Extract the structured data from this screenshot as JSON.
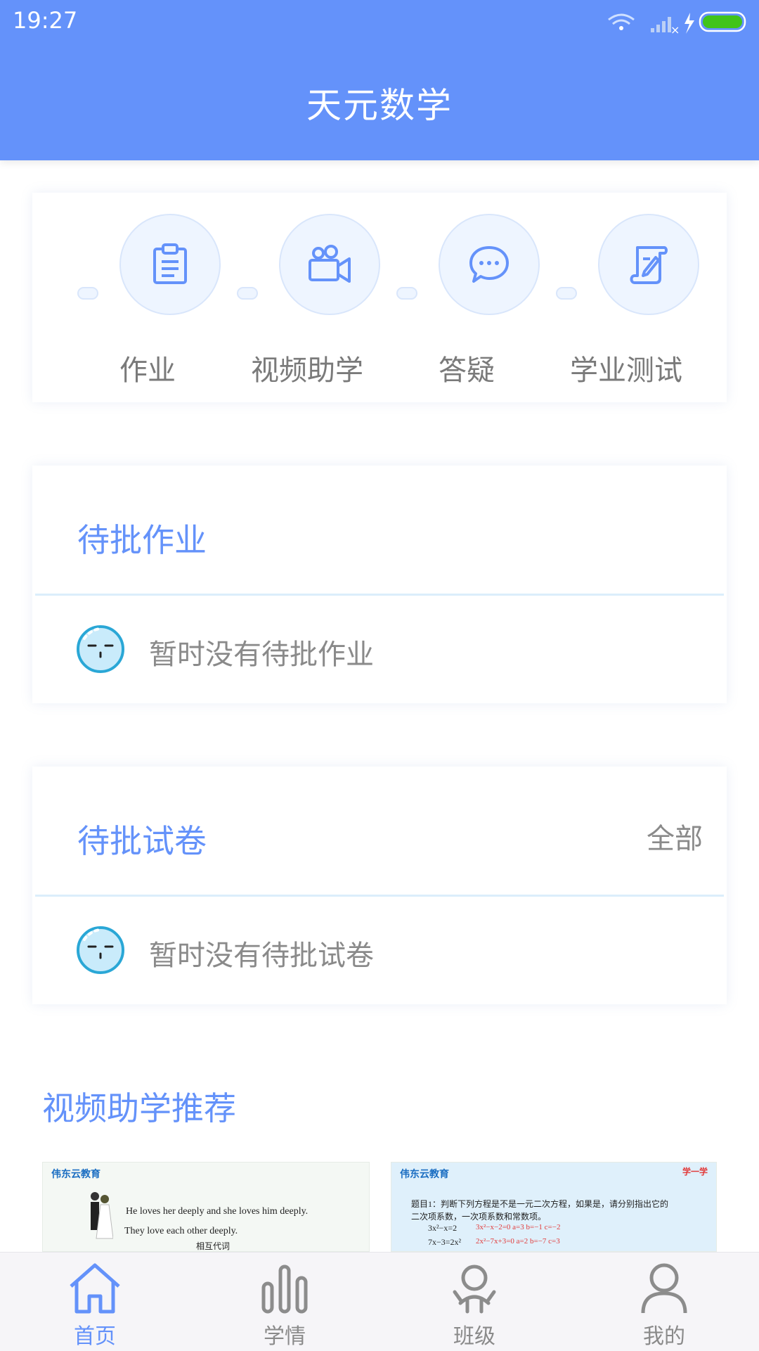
{
  "status_bar": {
    "time": "19:27"
  },
  "app": {
    "title": "天元数学"
  },
  "quick_actions": [
    {
      "label": "作业",
      "icon": "clipboard-icon"
    },
    {
      "label": "视频助学",
      "icon": "video-camera-icon"
    },
    {
      "label": "答疑",
      "icon": "chat-bubble-icon"
    },
    {
      "label": "学业测试",
      "icon": "test-scroll-icon"
    }
  ],
  "pending_homework": {
    "title": "待批作业",
    "empty_text": "暂时没有待批作业"
  },
  "pending_exams": {
    "title": "待批试卷",
    "all_label": "全部",
    "empty_text": "暂时没有待批试卷"
  },
  "video_section": {
    "title": "视频助学推荐",
    "videos": [
      {
        "logo": "伟东云教育",
        "line1": "He loves her deeply and she loves him deeply.",
        "line2": "They love each other deeply.",
        "line3": "相互代词"
      },
      {
        "logo": "伟东云教育",
        "corner": "学一学",
        "line1": "题目1：判断下列方程是不是一元二次方程，如果是，请分别指出它的",
        "line2": "二次项系数，一次项系数和常数项。",
        "line3": "3x²−x=2",
        "line3_red": "3x²−x−2=0   a=3   b=−1   c=−2",
        "line4": "7x−3=2x²",
        "line4_red": "2x²−7x+3=0   a=2   b=−7   c=3"
      }
    ]
  },
  "tabbar": {
    "items": [
      {
        "label": "首页",
        "icon": "home-icon",
        "active": true
      },
      {
        "label": "学情",
        "icon": "bar-chart-icon",
        "active": false
      },
      {
        "label": "班级",
        "icon": "class-group-icon",
        "active": false
      },
      {
        "label": "我的",
        "icon": "person-icon",
        "active": false
      }
    ]
  },
  "colors": {
    "primary": "#6492fa",
    "text_gray": "#8a8a8a",
    "tab_bg": "#f6f5f8"
  }
}
